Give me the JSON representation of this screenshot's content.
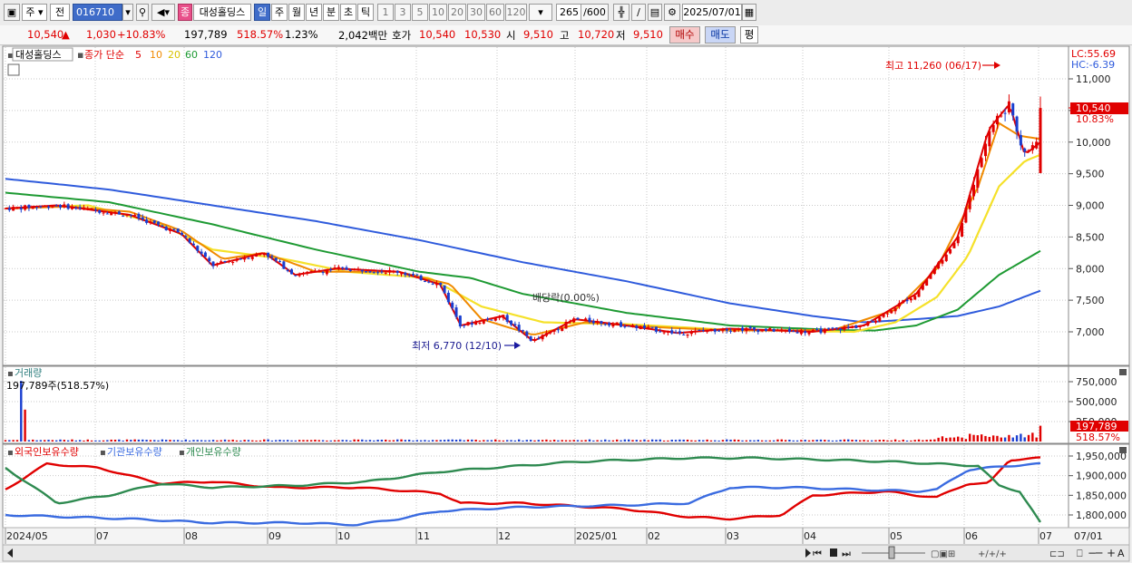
{
  "toolbar": {
    "market_label": "주",
    "prev_label": "전",
    "stock_code": "016710",
    "stock_badge": "종",
    "stock_name": "대성홀딩스",
    "periods": [
      "일",
      "주",
      "월",
      "년",
      "분",
      "초",
      "틱"
    ],
    "period_numbers": [
      "1",
      "3",
      "5",
      "10",
      "20",
      "30",
      "60",
      "120"
    ],
    "count_value": "265",
    "count_max": "/600",
    "date_value": "2025/07/01"
  },
  "quote": {
    "price": "10,540",
    "change_arrow": "▲",
    "change": "1,030",
    "change_pct": "+10.83%",
    "volume": "197,789",
    "volume_ratio": "518.57%",
    "turnover": "1.23%",
    "amount": "2,042백만",
    "ask_label": "호가",
    "ask1": "10,540",
    "ask2": "10,530",
    "open_label": "시",
    "open": "9,510",
    "high_label": "고",
    "high": "10,720",
    "low_label": "저",
    "low": "9,510",
    "buy_label": "매수",
    "sell_label": "매도",
    "eval_label": "평"
  },
  "price_panel": {
    "name_tag": "대성홀딩스",
    "legend_label": "종가 단순",
    "ma_labels": [
      "5",
      "10",
      "20",
      "60",
      "120"
    ],
    "ma_colors": [
      "#e00000",
      "#f08a00",
      "#f5e12a",
      "#1e9a33",
      "#2f5bdc"
    ],
    "lc": "LC:55.69",
    "hc": "HC:-6.39",
    "max_annotation": "최고 11,260 (06/17)",
    "min_annotation": "최저 6,770 (12/10)",
    "dividend_annotation": "배당락(0.00%)",
    "current_price_tag": "10,540",
    "current_pct_tag": "10.83%"
  },
  "volume_panel": {
    "title": "거래량",
    "info": "197,789주(518.57%)",
    "current_tag": "197,789",
    "pct_tag": "518.57%"
  },
  "holdings_panel": {
    "series_labels": [
      "외국인보유수량",
      "기관보유수량",
      "개인보유수량"
    ],
    "series_colors": [
      "#e00000",
      "#3a6be0",
      "#2e8a50"
    ]
  },
  "chart_data": {
    "type": "candlestick",
    "price_ticks": [
      7000,
      7500,
      8000,
      8500,
      9000,
      9500,
      10000,
      10500,
      11000
    ],
    "price_tick_labels": [
      "7,000",
      "7,500",
      "8,000",
      "8,500",
      "9,000",
      "9,500",
      "10,000",
      "10,500",
      "11,000"
    ],
    "volume_ticks": [
      250000,
      500000,
      750000
    ],
    "volume_tick_labels": [
      "250,000",
      "500,000",
      "750,000"
    ],
    "holdings_ticks": [
      1800000,
      1850000,
      1900000,
      1950000
    ],
    "holdings_tick_labels": [
      "1,800,000",
      "1,850,000",
      "1,900,000",
      "1,950,000"
    ],
    "x_labels": [
      "2024/05",
      "07",
      "08",
      "09",
      "10",
      "11",
      "12",
      "2025/01",
      "02",
      "03",
      "04",
      "05",
      "06",
      "07",
      "07/01"
    ],
    "annotations": {
      "high": 11260,
      "high_date": "06/17",
      "low": 6770,
      "low_date": "12/10"
    },
    "close_price": 10540,
    "ma_anchor": [
      {
        "ma5": [
          [
            0,
            8950
          ],
          [
            0.05,
            9000
          ],
          [
            0.12,
            8850
          ],
          [
            0.17,
            8550
          ],
          [
            0.2,
            8050
          ],
          [
            0.25,
            8250
          ],
          [
            0.28,
            7900
          ],
          [
            0.32,
            8000
          ],
          [
            0.38,
            7950
          ],
          [
            0.42,
            7750
          ],
          [
            0.44,
            7100
          ],
          [
            0.48,
            7250
          ],
          [
            0.51,
            6850
          ],
          [
            0.55,
            7200
          ],
          [
            0.6,
            7100
          ],
          [
            0.65,
            6980
          ],
          [
            0.7,
            7050
          ],
          [
            0.78,
            7000
          ],
          [
            0.83,
            7100
          ],
          [
            0.88,
            7600
          ],
          [
            0.92,
            8500
          ],
          [
            0.95,
            10200
          ],
          [
            0.97,
            10600
          ],
          [
            0.985,
            9800
          ],
          [
            1,
            10000
          ]
        ]
      },
      {
        "ma10": [
          [
            0,
            8950
          ],
          [
            0.06,
            8980
          ],
          [
            0.12,
            8900
          ],
          [
            0.17,
            8600
          ],
          [
            0.21,
            8150
          ],
          [
            0.25,
            8250
          ],
          [
            0.3,
            7950
          ],
          [
            0.38,
            7950
          ],
          [
            0.43,
            7750
          ],
          [
            0.46,
            7200
          ],
          [
            0.51,
            6950
          ],
          [
            0.56,
            7150
          ],
          [
            0.62,
            7080
          ],
          [
            0.7,
            7020
          ],
          [
            0.8,
            7030
          ],
          [
            0.86,
            7350
          ],
          [
            0.9,
            8000
          ],
          [
            0.94,
            9300
          ],
          [
            0.96,
            10300
          ],
          [
            0.98,
            10100
          ],
          [
            1,
            10050
          ]
        ]
      },
      {
        "ma20": [
          [
            0,
            8950
          ],
          [
            0.08,
            9000
          ],
          [
            0.15,
            8700
          ],
          [
            0.2,
            8300
          ],
          [
            0.27,
            8150
          ],
          [
            0.33,
            7950
          ],
          [
            0.41,
            7850
          ],
          [
            0.46,
            7400
          ],
          [
            0.52,
            7150
          ],
          [
            0.6,
            7120
          ],
          [
            0.7,
            7030
          ],
          [
            0.82,
            7000
          ],
          [
            0.86,
            7150
          ],
          [
            0.9,
            7550
          ],
          [
            0.93,
            8200
          ],
          [
            0.96,
            9300
          ],
          [
            0.985,
            9700
          ],
          [
            1,
            9800
          ]
        ]
      },
      {
        "ma60": [
          [
            0,
            9200
          ],
          [
            0.1,
            9050
          ],
          [
            0.2,
            8700
          ],
          [
            0.3,
            8300
          ],
          [
            0.4,
            7950
          ],
          [
            0.45,
            7850
          ],
          [
            0.5,
            7600
          ],
          [
            0.6,
            7300
          ],
          [
            0.7,
            7100
          ],
          [
            0.8,
            7030
          ],
          [
            0.84,
            7020
          ],
          [
            0.88,
            7100
          ],
          [
            0.92,
            7350
          ],
          [
            0.96,
            7900
          ],
          [
            1,
            8280
          ]
        ]
      },
      {
        "ma120": [
          [
            0,
            9420
          ],
          [
            0.1,
            9250
          ],
          [
            0.2,
            9000
          ],
          [
            0.3,
            8750
          ],
          [
            0.4,
            8450
          ],
          [
            0.5,
            8100
          ],
          [
            0.6,
            7800
          ],
          [
            0.7,
            7450
          ],
          [
            0.78,
            7250
          ],
          [
            0.83,
            7150
          ],
          [
            0.88,
            7200
          ],
          [
            0.92,
            7250
          ],
          [
            0.96,
            7400
          ],
          [
            1,
            7650
          ]
        ]
      }
    ],
    "holdings_anchor": [
      {
        "foreign": [
          [
            0,
            1865
          ],
          [
            0.04,
            1930
          ],
          [
            0.09,
            1920
          ],
          [
            0.15,
            1880
          ],
          [
            0.2,
            1885
          ],
          [
            0.26,
            1870
          ],
          [
            0.34,
            1870
          ],
          [
            0.42,
            1855
          ],
          [
            0.44,
            1830
          ],
          [
            0.5,
            1830
          ],
          [
            0.6,
            1815
          ],
          [
            0.66,
            1795
          ],
          [
            0.7,
            1790
          ],
          [
            0.75,
            1800
          ],
          [
            0.78,
            1850
          ],
          [
            0.85,
            1860
          ],
          [
            0.88,
            1850
          ],
          [
            0.9,
            1845
          ],
          [
            0.93,
            1880
          ],
          [
            0.95,
            1880
          ],
          [
            0.97,
            1940
          ],
          [
            1,
            1945
          ]
        ]
      },
      {
        "institution": [
          [
            0,
            1800
          ],
          [
            0.06,
            1795
          ],
          [
            0.12,
            1790
          ],
          [
            0.2,
            1780
          ],
          [
            0.28,
            1780
          ],
          [
            0.34,
            1775
          ],
          [
            0.38,
            1790
          ],
          [
            0.42,
            1810
          ],
          [
            0.5,
            1820
          ],
          [
            0.6,
            1825
          ],
          [
            0.66,
            1830
          ],
          [
            0.7,
            1870
          ],
          [
            0.76,
            1870
          ],
          [
            0.82,
            1865
          ],
          [
            0.88,
            1860
          ],
          [
            0.9,
            1865
          ],
          [
            0.93,
            1915
          ],
          [
            0.95,
            1920
          ],
          [
            0.97,
            1925
          ],
          [
            1,
            1930
          ]
        ]
      },
      {
        "individual": [
          [
            0,
            1920
          ],
          [
            0.05,
            1830
          ],
          [
            0.1,
            1850
          ],
          [
            0.15,
            1880
          ],
          [
            0.2,
            1870
          ],
          [
            0.28,
            1875
          ],
          [
            0.35,
            1885
          ],
          [
            0.42,
            1910
          ],
          [
            0.47,
            1920
          ],
          [
            0.55,
            1935
          ],
          [
            0.6,
            1940
          ],
          [
            0.66,
            1945
          ],
          [
            0.72,
            1945
          ],
          [
            0.8,
            1940
          ],
          [
            0.86,
            1935
          ],
          [
            0.9,
            1930
          ],
          [
            0.94,
            1925
          ],
          [
            0.96,
            1875
          ],
          [
            0.98,
            1860
          ],
          [
            1,
            1780
          ]
        ]
      }
    ]
  }
}
